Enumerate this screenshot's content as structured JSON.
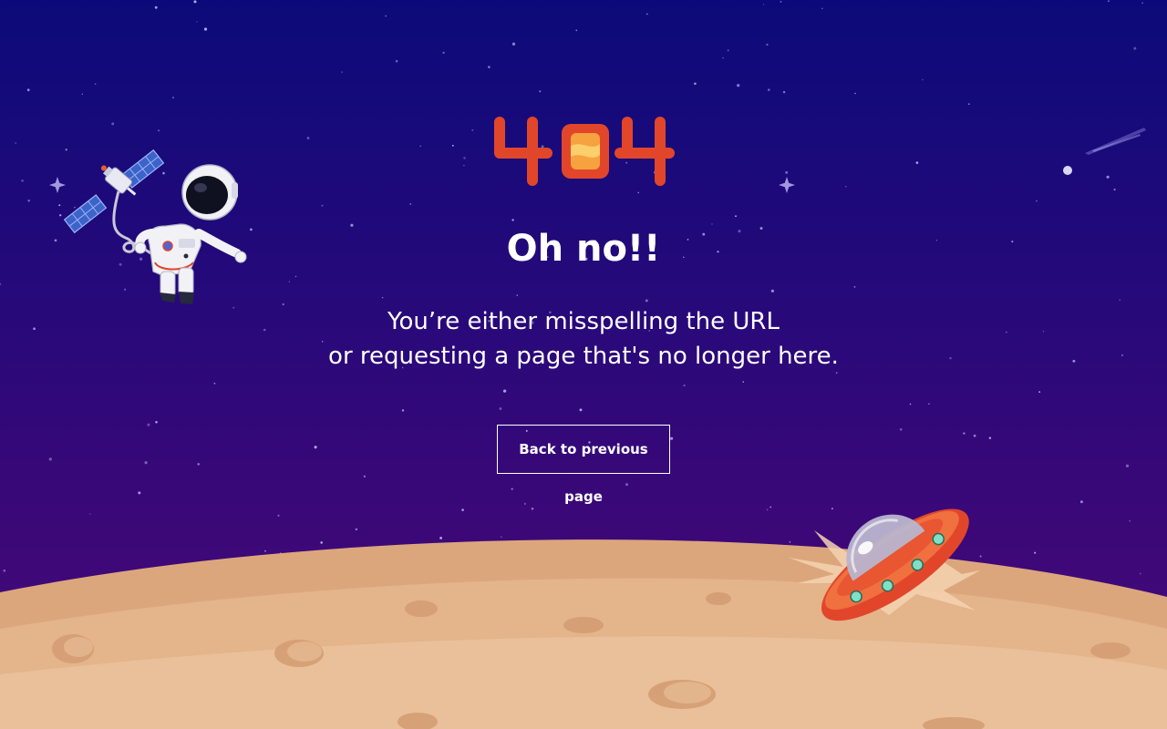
{
  "logo": {
    "text": "404",
    "icon": "404-logo"
  },
  "headline": "Oh no!!",
  "message": {
    "line1": "You’re either misspelling the URL",
    "line2": "or requesting a page that's no longer here."
  },
  "back_button": {
    "label": "Back to previous page"
  },
  "colors": {
    "background_top": "#0c0a7a",
    "background_bottom": "#4a0a7a",
    "accent_orange": "#e2462a",
    "moon_surface": "#e4b48a"
  },
  "decorations": {
    "astronaut": "astronaut-icon",
    "satellite": "satellite-icon",
    "ufo": "ufo-icon",
    "comet": "comet-icon",
    "moon": "moon-surface"
  }
}
